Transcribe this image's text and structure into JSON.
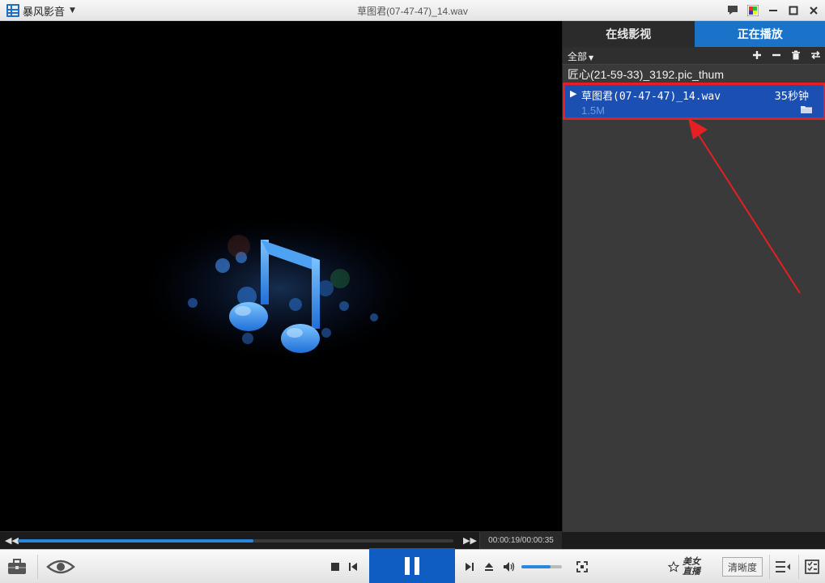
{
  "app": {
    "logo_text": "暴风影音",
    "window_title": "草图君(07-47-47)_14.wav"
  },
  "titlebar": {
    "icons": [
      "chat-icon",
      "skin-icon",
      "minimize-icon",
      "maximize-icon",
      "close-icon"
    ]
  },
  "panel": {
    "tabs": [
      {
        "label": "在线影视",
        "active": false
      },
      {
        "label": "正在播放",
        "active": true
      }
    ],
    "filter_label": "全部",
    "toolbar_icons": [
      "add-icon",
      "remove-icon",
      "trash-icon",
      "loop-icon"
    ],
    "items": [
      {
        "name": "匠心(21-59-33)_3192.pic_thum"
      },
      {
        "name": "草图君(07-47-47)_14.wav",
        "duration": "35秒钟",
        "size": "1.5M",
        "selected": true
      }
    ]
  },
  "playback": {
    "current_time": "00:00:19",
    "total_time": "00:00:35",
    "time_separator": "/",
    "progress_fraction": 0.54,
    "volume_fraction": 0.72,
    "state": "playing"
  },
  "bottombar": {
    "beauty_label": "美女直播",
    "clarity_label": "清晰度"
  },
  "colors": {
    "accent": "#1a72c9",
    "selected_row": "#1b4fb1",
    "highlight_border": "#e51f24",
    "annotation_arrow": "#e51f24"
  }
}
